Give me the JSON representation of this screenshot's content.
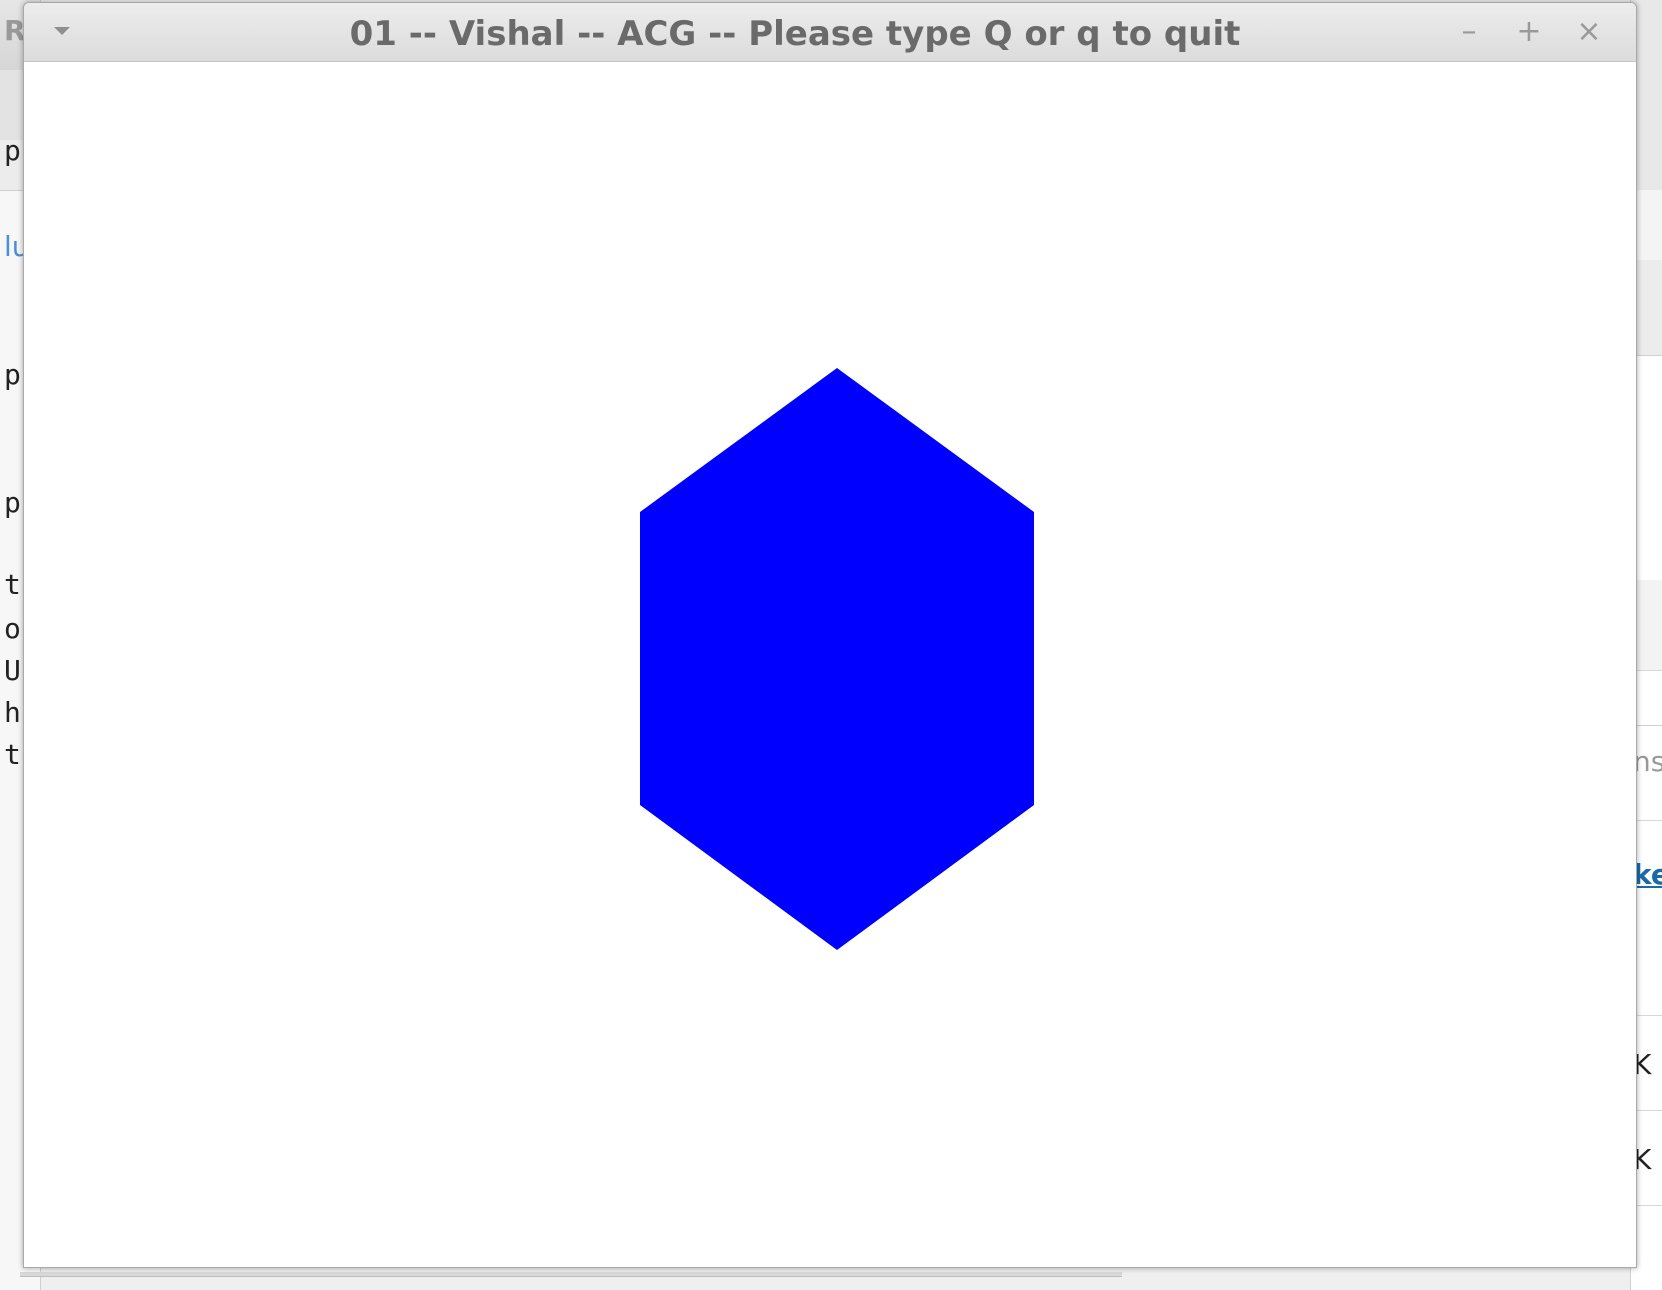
{
  "window": {
    "title": "01 -- Vishal -- ACG -- Please type Q or q to quit",
    "controls": {
      "menu_icon": "chevron-down-icon",
      "minimize_label": "–",
      "maximize_label": "+",
      "close_label": "×"
    }
  },
  "canvas": {
    "background_color": "#ffffff",
    "shape": {
      "type": "hexagon",
      "fill_color": "#0000ff"
    }
  },
  "background_windows": {
    "left_fragments": [
      "RA",
      "p",
      "lu",
      "p",
      "p",
      "t",
      "o",
      "U",
      "h",
      "t"
    ],
    "right_fragments": [
      "ns",
      "ke",
      "K",
      "K"
    ]
  }
}
